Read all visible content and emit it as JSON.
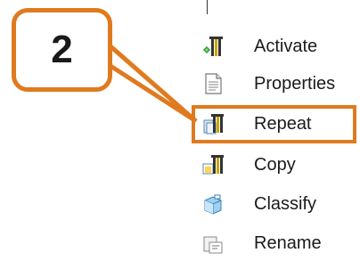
{
  "callout": {
    "number": "2",
    "color": "#e07a1e"
  },
  "menu": {
    "items": [
      {
        "label": "Activate",
        "icon": "activate-icon"
      },
      {
        "label": "Properties",
        "icon": "properties-icon"
      },
      {
        "label": "Repeat",
        "icon": "repeat-icon",
        "highlighted": true
      },
      {
        "label": "Copy",
        "icon": "copy-icon"
      },
      {
        "label": "Classify",
        "icon": "classify-icon"
      },
      {
        "label": "Rename",
        "icon": "rename-icon"
      }
    ]
  }
}
